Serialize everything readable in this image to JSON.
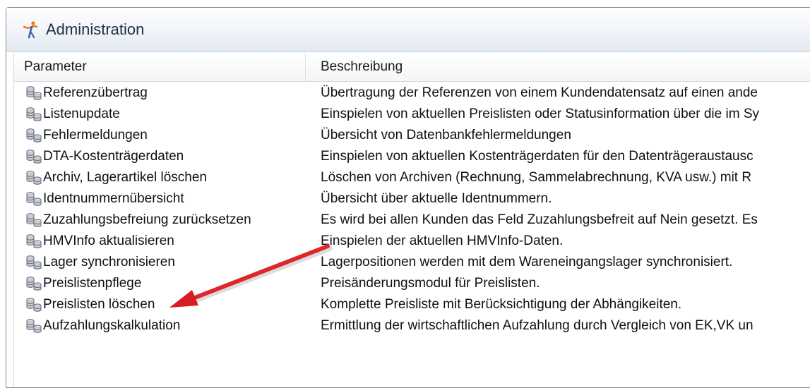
{
  "window": {
    "title": "Administration",
    "icon": "administration-figure-icon"
  },
  "columns": {
    "parameter": "Parameter",
    "description": "Beschreibung"
  },
  "rows": [
    {
      "name": "Referenzübertrag",
      "description": "Übertragung der Referenzen von einem Kundendatensatz auf einen ande",
      "icon": "database-icon"
    },
    {
      "name": "Listenupdate",
      "description": "Einspielen von aktuellen Preislisten oder Statusinformation über die im Sy",
      "icon": "database-icon"
    },
    {
      "name": "Fehlermeldungen",
      "description": "Übersicht von Datenbankfehlermeldungen",
      "icon": "database-icon"
    },
    {
      "name": "DTA-Kostenträgerdaten",
      "description": "Einspielen von aktuellen Kostenträgerdaten für den Datenträgeraustausc",
      "icon": "database-icon"
    },
    {
      "name": "Archiv, Lagerartikel löschen",
      "description": "Löschen von Archiven (Rechnung, Sammelabrechnung, KVA usw.) mit R",
      "icon": "database-icon"
    },
    {
      "name": "Identnummernübersicht",
      "description": "Übersicht über aktuelle Identnummern.",
      "icon": "database-icon"
    },
    {
      "name": "Zuzahlungsbefreiung zurücksetzen",
      "description": "Es wird bei allen Kunden das Feld Zuzahlungsbefreit auf Nein gesetzt. Es",
      "icon": "database-icon"
    },
    {
      "name": "HMVInfo aktualisieren",
      "description": "Einspielen der aktuellen HMVInfo-Daten.",
      "icon": "database-icon"
    },
    {
      "name": "Lager synchronisieren",
      "description": "Lagerpositionen werden mit dem Wareneingangslager synchronisiert.",
      "icon": "database-icon"
    },
    {
      "name": "Preislistenpflege",
      "description": "Preisänderungsmodul für Preislisten.",
      "icon": "database-icon"
    },
    {
      "name": "Preislisten löschen",
      "description": "Komplette Preisliste mit Berücksichtigung der Abhängikeiten.",
      "icon": "database-icon"
    },
    {
      "name": "Aufzahlungskalkulation",
      "description": "Ermittlung der wirtschaftlichen Aufzahlung durch Vergleich von EK,VK un",
      "icon": "database-icon"
    }
  ],
  "annotation": {
    "icon": "red-arrow-icon",
    "color": "#e8202a"
  }
}
